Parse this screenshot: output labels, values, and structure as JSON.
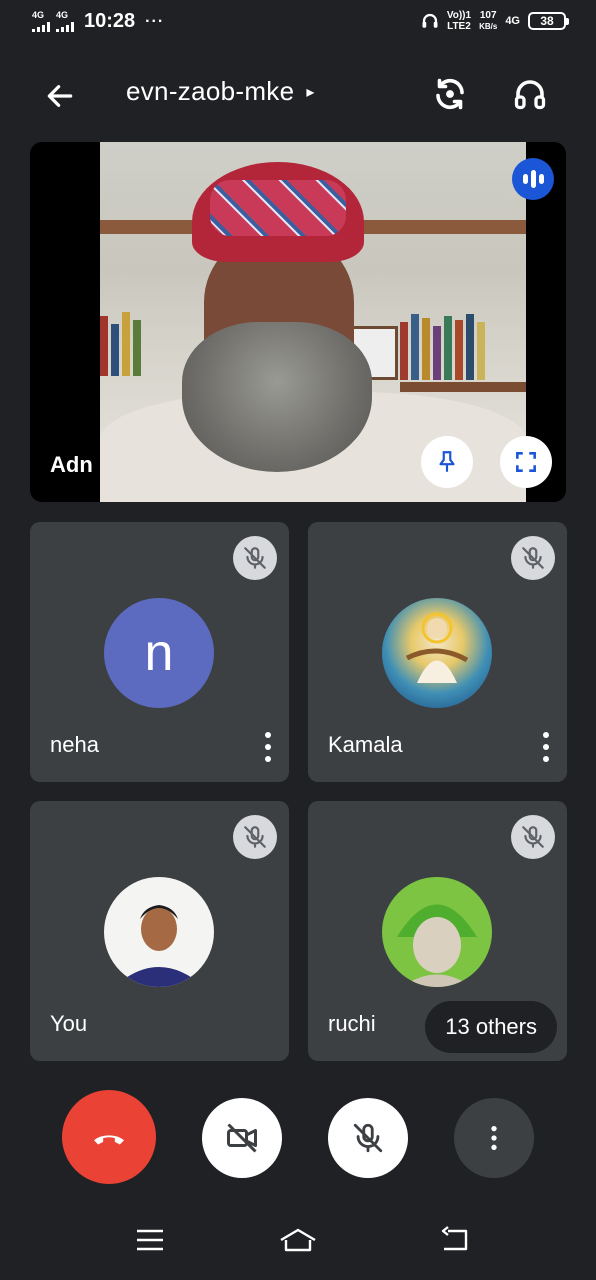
{
  "status_bar": {
    "sim1_type": "4G",
    "sim2_type": "4G",
    "time": "10:28",
    "more_indicator": "···",
    "volte_label": "Vo))1",
    "volte_sub": "LTE2",
    "speed_value": "107",
    "speed_unit": "KB/s",
    "network_type": "4G",
    "battery_level": "38"
  },
  "header": {
    "meeting_code": "evn-zaob-mke",
    "caret": "▸",
    "icons": [
      "back-arrow-icon",
      "switch-camera-icon",
      "headphones-icon"
    ]
  },
  "main_tile": {
    "participant_name": "Adn",
    "speaking_indicator_icon": "audio-waves-icon",
    "pin_icon": "pin-icon",
    "fullscreen_icon": "fullscreen-icon"
  },
  "participants": [
    {
      "name": "neha",
      "avatar_letter": "n",
      "avatar_color": "#5c6bc0",
      "muted": true,
      "has_menu": true
    },
    {
      "name": "Kamala",
      "avatar_type": "photo",
      "muted": true,
      "has_menu": true
    },
    {
      "name": "You",
      "avatar_type": "photo",
      "muted": true,
      "has_menu": false
    },
    {
      "name": "ruchi",
      "avatar_type": "photo",
      "muted": true,
      "has_menu": false
    }
  ],
  "others_chip": {
    "label": "13 others"
  },
  "controls": {
    "end_call_color": "#ea4335",
    "buttons": [
      "end-call-icon",
      "camera-off-icon",
      "mic-off-icon",
      "more-options-icon"
    ]
  },
  "nav_bar": {
    "buttons": [
      "menu-icon",
      "home-icon",
      "back-icon"
    ]
  }
}
